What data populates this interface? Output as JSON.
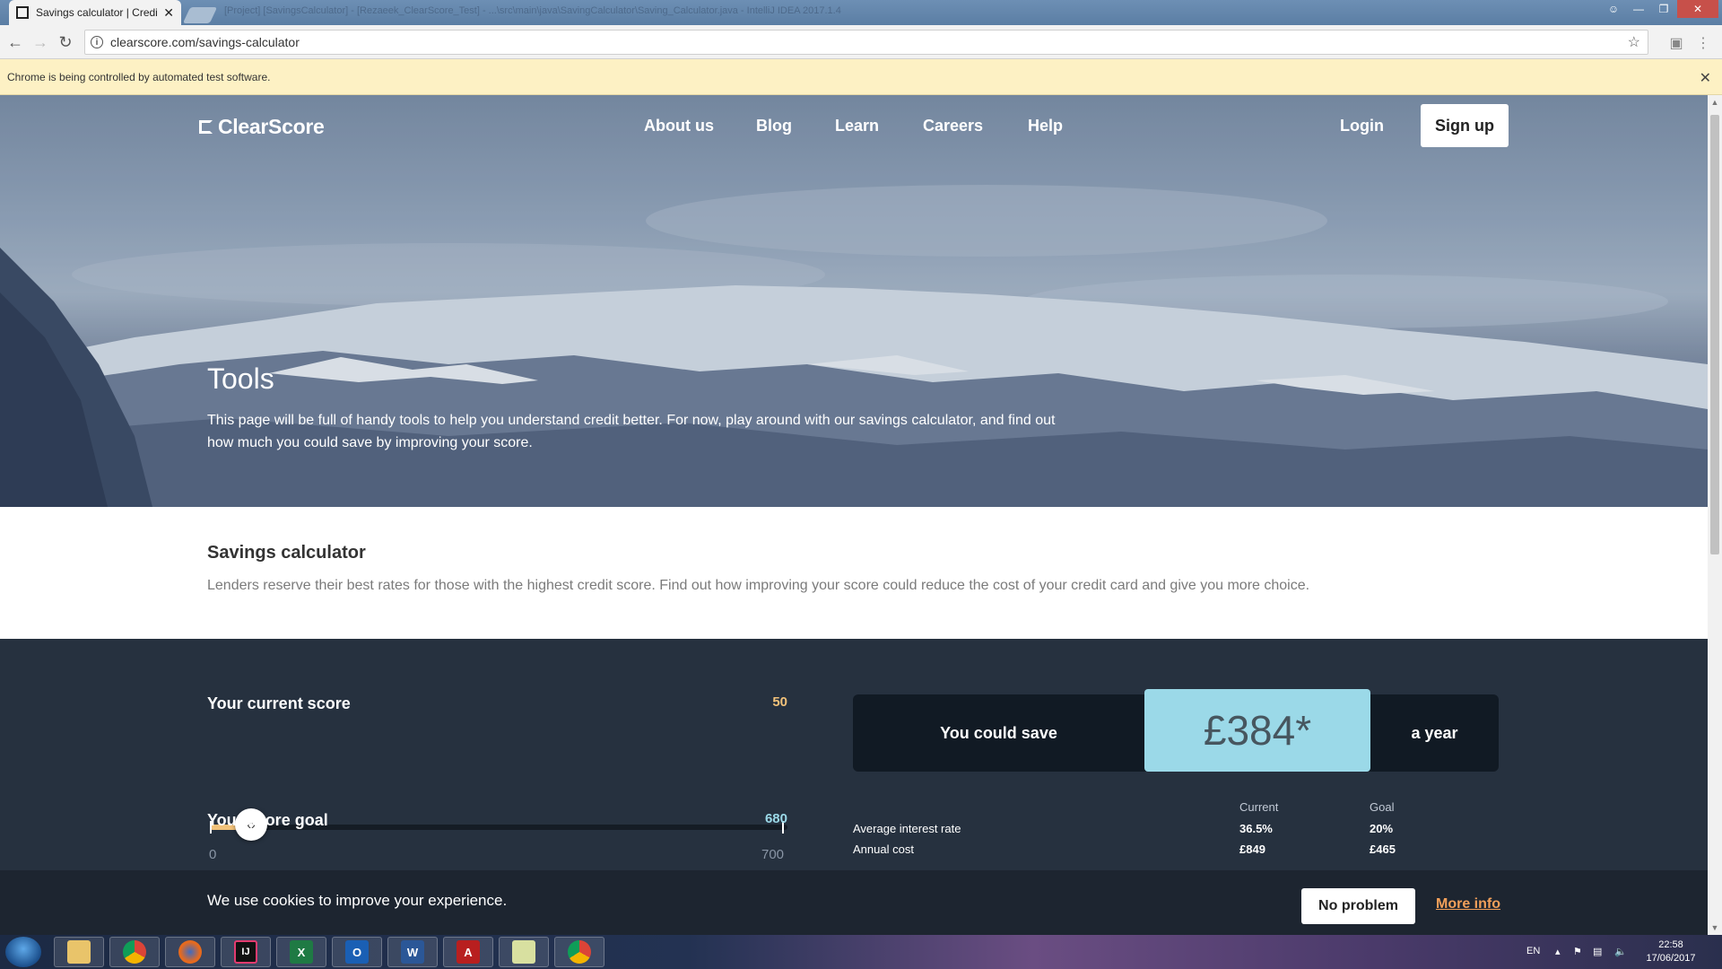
{
  "browser": {
    "tab_title": "Savings calculator | Credi",
    "tab_close": "✕",
    "background_title": "[Project] [SavingsCalculator] - [Rezaeek_ClearScore_Test] - ...\\src\\main\\java\\SavingCalculator\\Saving_Calculator.java - IntelliJ IDEA 2017.1.4",
    "url": "clearscore.com/savings-calculator",
    "infobar_text": "Chrome is being controlled by automated test software."
  },
  "site": {
    "logo": "ClearScore",
    "nav": [
      "About us",
      "Blog",
      "Learn",
      "Careers",
      "Help"
    ],
    "login": "Login",
    "signup": "Sign up"
  },
  "hero": {
    "title": "Tools",
    "description": "This page will be full of handy tools to help you understand credit better. For now, play around with our savings calculator, and find out how much you could save by improving your score."
  },
  "intro": {
    "title": "Savings calculator",
    "description": "Lenders reserve their best rates for those with the highest credit score. Find out how improving your score could reduce the cost of your credit card and give you more choice."
  },
  "calculator": {
    "current": {
      "label": "Your current score",
      "value": "50",
      "value_num": 50,
      "min": "0",
      "max": "700",
      "max_num": 700,
      "color": "#f2c27a"
    },
    "goal": {
      "label": "Your score goal",
      "value": "680",
      "value_num": 680,
      "max_num": 700,
      "color": "#9bd9e8"
    },
    "save": {
      "label": "You could save",
      "amount": "£384*",
      "period": "a year"
    },
    "comparison": {
      "head_current": "Current",
      "head_goal": "Goal",
      "rows": [
        {
          "label": "Average interest rate",
          "current": "36.5%",
          "goal": "20%"
        },
        {
          "label": "Annual cost",
          "current": "£849",
          "goal": "£465"
        }
      ]
    }
  },
  "cookie": {
    "text": "We use cookies to improve your experience.",
    "accept": "No problem",
    "more": "More info"
  },
  "taskbar": {
    "apps": [
      "folder",
      "chrome",
      "firefox",
      "intellij",
      "excel",
      "outlook",
      "word",
      "acrobat",
      "project",
      "chrome"
    ],
    "lang": "EN",
    "time": "22:58",
    "date": "17/06/2017"
  },
  "colors": {
    "accent_orange": "#f2a05a",
    "accent_blue": "#9bd9e8",
    "calc_bg": "#26313f"
  }
}
